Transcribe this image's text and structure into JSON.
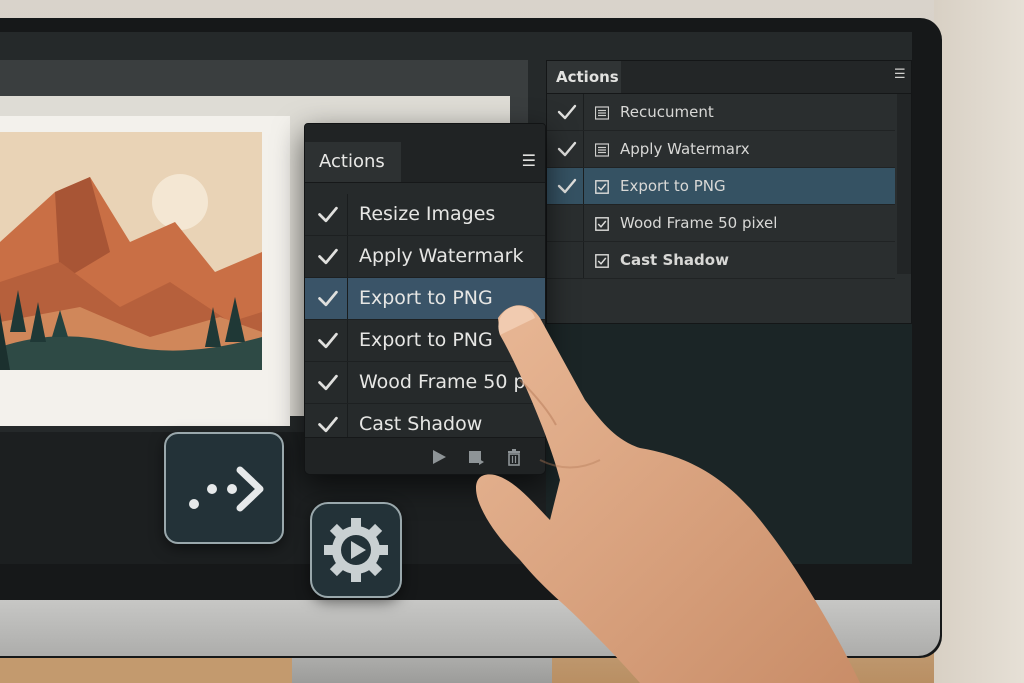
{
  "small_panel": {
    "title": "Actions",
    "menu_icon": "hamburger-icon",
    "items": [
      {
        "label": "Recucument",
        "checked": true,
        "icon": "list-icon",
        "selected": false,
        "bold": false
      },
      {
        "label": "Apply Watermarx",
        "checked": true,
        "icon": "list-icon",
        "selected": false,
        "bold": false
      },
      {
        "label": "Export to PNG",
        "checked": true,
        "icon": "checkbox-icon",
        "selected": true,
        "bold": false
      },
      {
        "label": "Wood Frame 50 pixel",
        "checked": false,
        "icon": "checkbox-icon",
        "selected": false,
        "bold": false
      },
      {
        "label": "Cast Shadow",
        "checked": false,
        "icon": "checkbox-icon",
        "selected": false,
        "bold": true
      }
    ]
  },
  "big_panel": {
    "title": "Actions",
    "menu_icon": "hamburger-icon",
    "items": [
      {
        "label": "Resize Images",
        "checked": true,
        "selected": false
      },
      {
        "label": "Apply Watermark",
        "checked": true,
        "selected": false
      },
      {
        "label": "Export to PNG",
        "checked": true,
        "selected": true
      },
      {
        "label": "Export to PNG",
        "checked": true,
        "selected": false
      },
      {
        "label": "Wood Frame 50 p",
        "checked": true,
        "selected": false
      },
      {
        "label": "Cast Shadow",
        "checked": true,
        "selected": false
      }
    ],
    "footer_buttons": [
      "play-icon",
      "record-icon",
      "trash-icon"
    ]
  },
  "floating_icons": [
    "script-arrow-icon",
    "gear-play-icon"
  ],
  "colors": {
    "selection_small": "#355263",
    "selection_big": "#3a5468",
    "panel_bg": "#2a2e2f",
    "icon_tile_bg": "#233238"
  }
}
